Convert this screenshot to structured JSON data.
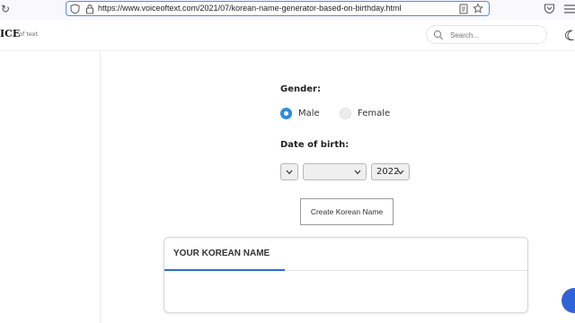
{
  "browser": {
    "url": "https://www.voiceoftext.com/2021/07/korean-name-generator-based-on-birthday.html"
  },
  "site": {
    "logo": "ICE",
    "logo_sub": "of text",
    "search_placeholder": "Search..."
  },
  "form": {
    "gender_label": "Gender:",
    "male_label": "Male",
    "female_label": "Female",
    "selected_gender": "Male",
    "dob_label": "Date of birth:",
    "day_value": "",
    "month_value": "",
    "year_value": "2022",
    "create_button": "Create Korean Name"
  },
  "result": {
    "title": "YOUR KOREAN NAME"
  },
  "colors": {
    "accent": "#2b8de3",
    "tab_underline": "#2b6fd6",
    "url_focus": "#4f8cf0"
  }
}
